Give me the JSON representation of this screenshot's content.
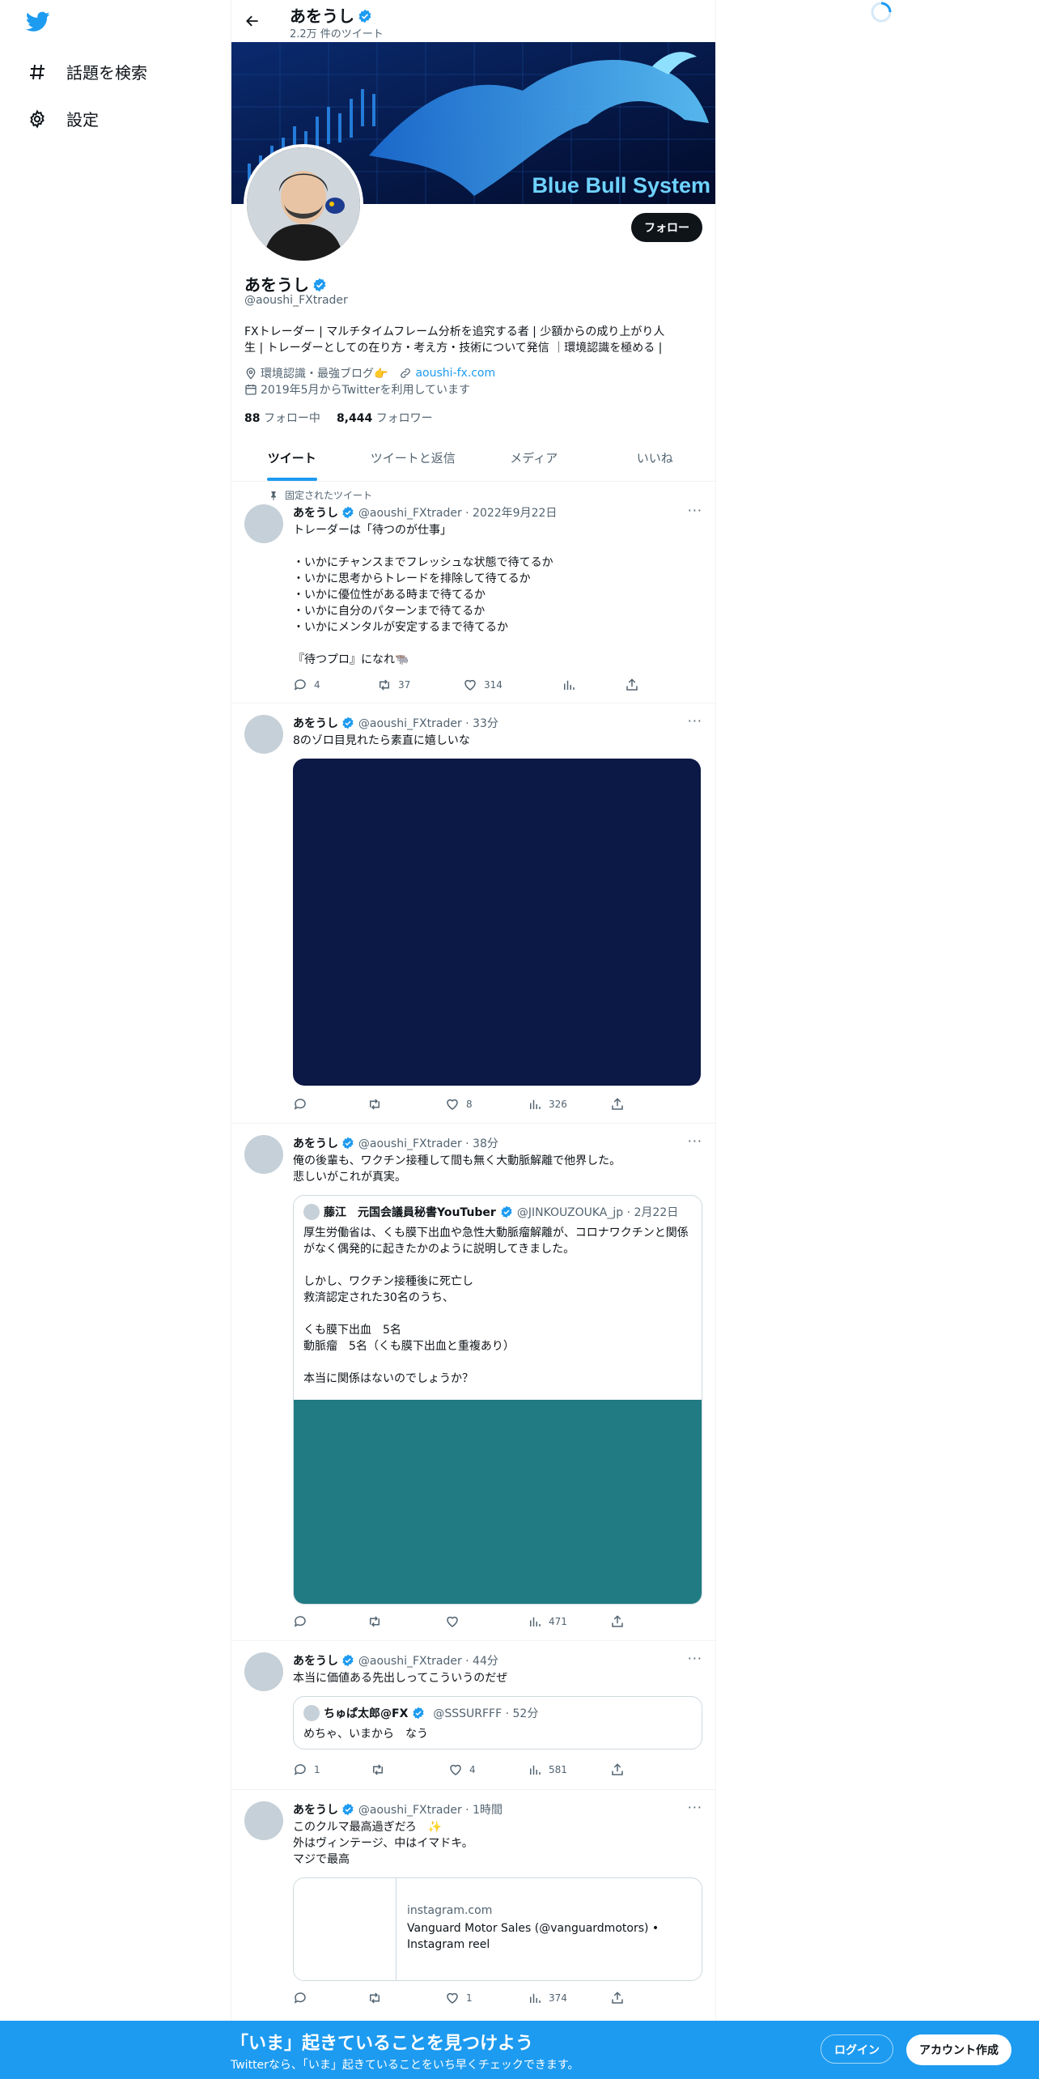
{
  "sidebar": {
    "items": [
      {
        "label": "話題を検索",
        "icon": "hashtag-icon"
      },
      {
        "label": "設定",
        "icon": "gear-icon"
      }
    ]
  },
  "header": {
    "name": "あをうし",
    "tweet_count": "2.2万 件のツイート"
  },
  "banner": {
    "text": "Blue Bull System"
  },
  "profile": {
    "follow_label": "フォロー",
    "name": "あをうし",
    "handle": "@aoushi_FXtrader",
    "bio_line1": "FXトレーダー | マルチタイムフレーム分析を追究する者 | 少額からの成り上がり人",
    "bio_line2": "生 | トレーダーとしての在り方・考え方・技術について発信 ｜環境認識を極める |",
    "location": "環境認識・最強ブログ👉",
    "url": "aoushi-fx.com",
    "joined": "2019年5月からTwitterを利用しています",
    "following_count": "88",
    "following_label": "フォロー中",
    "followers_count": "8,444",
    "followers_label": "フォロワー"
  },
  "tabs": [
    "ツイート",
    "ツイートと返信",
    "メディア",
    "いいね"
  ],
  "tweets": [
    {
      "pinned_label": "固定されたツイート",
      "name": "あをうし",
      "meta": "@aoushi_FXtrader · 2022年9月22日",
      "text": "トレーダーは「待つのが仕事」\n\n・いかにチャンスまでフレッシュな状態で待てるか\n・いかに思考からトレードを排除して待てるか\n・いかに優位性がある時まで待てるか\n・いかに自分のパターンまで待てるか\n・いかにメンタルが安定するまで待てるか\n\n『待つプロ』になれ🐃",
      "replies": "4",
      "retweets": "37",
      "likes": "314",
      "views": ""
    },
    {
      "name": "あをうし",
      "meta": "@aoushi_FXtrader · 33分",
      "text": "8のゾロ目見れたら素直に嬉しいな",
      "replies": "",
      "retweets": "",
      "likes": "8",
      "views": "326",
      "media_color": "#0c1845"
    },
    {
      "name": "あをうし",
      "meta": "@aoushi_FXtrader · 38分",
      "text": "俺の後輩も、ワクチン接種して間も無く大動脈解離で他界した。\n悲しいがこれが真実。",
      "quote": {
        "name": "藤江　元国会議員秘書YouTuber",
        "meta": "@JINKOUZOUKA_jp · 2月22日",
        "text": "厚生労働省は、くも膜下出血や急性大動脈瘤解離が、コロナワクチンと関係がなく偶発的に起きたかのように説明してきました。\n\nしかし、ワクチン接種後に死亡し\n救済認定された30名のうち、\n\nくも膜下出血　5名\n動脈瘤　5名（くも膜下出血と重複あり）\n\n本当に関係はないのでしょうか？",
        "media_color": "#217b82"
      },
      "replies": "",
      "retweets": "",
      "likes": "",
      "views": "471"
    },
    {
      "name": "あをうし",
      "meta": "@aoushi_FXtrader · 44分",
      "text": "本当に価値ある先出しってこういうのだぜ",
      "quote": {
        "name": "ちゅぱ太郎@FX",
        "meta": "@SSSURFFF · 52分",
        "text": "めちゃ、いまから　なう"
      },
      "replies": "1",
      "retweets": "",
      "likes": "4",
      "views": "581"
    },
    {
      "name": "あをうし",
      "meta": "@aoushi_FXtrader · 1時間",
      "text": "このクルマ最高過ぎだろ　✨\n外はヴィンテージ、中はイマドキ。\nマジで最高",
      "card": {
        "domain": "instagram.com",
        "title_line1": "Vanguard Motor Sales (@vanguardmotors) •",
        "title_line2": "Instagram reel"
      },
      "replies": "",
      "retweets": "",
      "likes": "1",
      "views": "374"
    }
  ],
  "bottom_bar": {
    "title": "「いま」起きていることを見つけよう",
    "subtitle": "Twitterなら、「いま」起きていることをいち早くチェックできます。",
    "login_label": "ログイン",
    "signup_label": "アカウント作成"
  },
  "colors": {
    "accent": "#1d9bf0",
    "text": "#0f1419",
    "muted": "#536471"
  }
}
